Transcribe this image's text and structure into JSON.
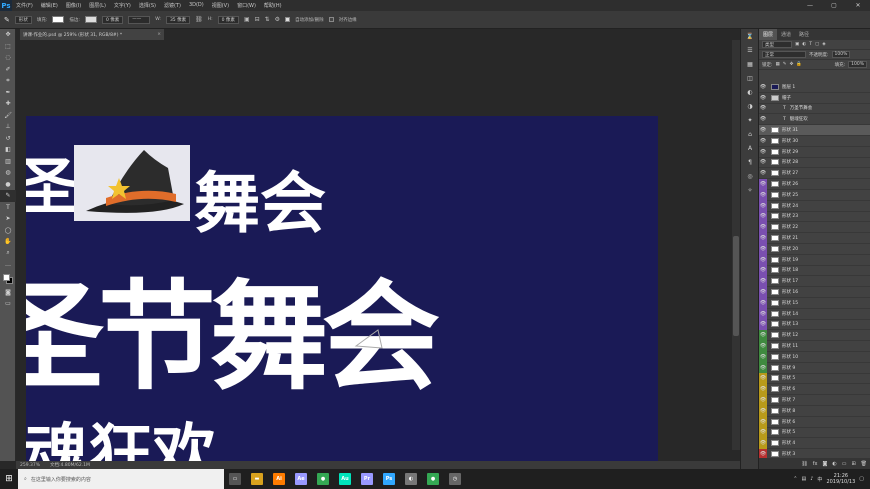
{
  "app": {
    "logo": "Ps"
  },
  "menu": [
    "文件(F)",
    "编辑(E)",
    "图像(I)",
    "图层(L)",
    "文字(Y)",
    "选择(S)",
    "滤镜(T)",
    "3D(D)",
    "视图(V)",
    "窗口(W)",
    "帮助(H)"
  ],
  "options": {
    "mode": "形状",
    "fill_label": "填充:",
    "stroke_label": "描边:",
    "stroke_width": "0 像素",
    "w_label": "W:",
    "w_value": "35 像素",
    "h_label": "H:",
    "h_value": "0 像素",
    "auto_add": "自动添加/删除",
    "align_edges": "对齐边缘"
  },
  "document": {
    "tab": "讲课·作业的.psd @ 259% (形状 31, RGB/8#) *",
    "close": "×",
    "zoom": "259.37%",
    "doc_info": "文档:4.80M/62.1M"
  },
  "panel": {
    "tabs": [
      "图层",
      "通道",
      "路径"
    ],
    "filter": "类型",
    "blend": "正常",
    "opacity_label": "不透明度:",
    "opacity": "100%",
    "lock_label": "锁定:",
    "fill_label": "填充:",
    "fill": "100%"
  },
  "layers": [
    {
      "name": "图层 1",
      "tag": ""
    },
    {
      "name": "帽子",
      "tag": ""
    },
    {
      "name": "万圣节舞会",
      "tag": ""
    },
    {
      "name": "魅魂狂欢",
      "tag": ""
    },
    {
      "name": "形状 31",
      "tag": ""
    },
    {
      "name": "形状 30",
      "tag": ""
    },
    {
      "name": "形状 29",
      "tag": ""
    },
    {
      "name": "形状 28",
      "tag": ""
    },
    {
      "name": "形状 27",
      "tag": ""
    },
    {
      "name": "形状 26",
      "tag": "#7a4fb0"
    },
    {
      "name": "形状 25",
      "tag": "#7a4fb0"
    },
    {
      "name": "形状 24",
      "tag": "#7a4fb0"
    },
    {
      "name": "形状 23",
      "tag": "#7a4fb0"
    },
    {
      "name": "形状 22",
      "tag": "#7a4fb0"
    },
    {
      "name": "形状 21",
      "tag": "#7a4fb0"
    },
    {
      "name": "形状 20",
      "tag": "#7a4fb0"
    },
    {
      "name": "形状 19",
      "tag": "#7a4fb0"
    },
    {
      "name": "形状 18",
      "tag": "#7a4fb0"
    },
    {
      "name": "形状 17",
      "tag": "#7a4fb0"
    },
    {
      "name": "形状 16",
      "tag": "#7a4fb0"
    },
    {
      "name": "形状 15",
      "tag": "#7a4fb0"
    },
    {
      "name": "形状 14",
      "tag": "#7a4fb0"
    },
    {
      "name": "形状 13",
      "tag": "#7a4fb0"
    },
    {
      "name": "形状 12",
      "tag": "#3f8a3f"
    },
    {
      "name": "形状 11",
      "tag": "#3f8a3f"
    },
    {
      "name": "形状 10",
      "tag": "#3f8a3f"
    },
    {
      "name": "形状 9",
      "tag": "#3f8a3f"
    },
    {
      "name": "形状 5",
      "tag": "#b89a1a"
    },
    {
      "name": "形状 6",
      "tag": "#b89a1a"
    },
    {
      "name": "形状 7",
      "tag": "#b89a1a"
    },
    {
      "name": "形状 8",
      "tag": "#b89a1a"
    },
    {
      "name": "形状 6",
      "tag": "#b89a1a"
    },
    {
      "name": "形状 5",
      "tag": "#b89a1a"
    },
    {
      "name": "形状 4",
      "tag": "#b89a1a"
    },
    {
      "name": "形状 3",
      "tag": "#b83030"
    },
    {
      "name": "形状 2",
      "tag": "#b83030"
    },
    {
      "name": "形状 1",
      "tag": "#b83030"
    }
  ],
  "canvas_text": {
    "line1": "圣",
    "line1b": "舞会",
    "line2": "圣节舞会",
    "line3": "魂狂欢"
  },
  "taskbar": {
    "search_placeholder": "在这里输入你要搜索的内容",
    "time": "21:26",
    "date": "2019/10/13",
    "lang": "中"
  },
  "taskbar_apps": [
    {
      "icon": "task-view",
      "color": "#555",
      "glyph": "▭"
    },
    {
      "icon": "file-explorer",
      "color": "#d9a21e",
      "glyph": "▬"
    },
    {
      "icon": "illustrator",
      "color": "#ff7c00",
      "glyph": "Ai"
    },
    {
      "icon": "after-effects",
      "color": "#9999ff",
      "glyph": "Ae"
    },
    {
      "icon": "chrome",
      "color": "#34a853",
      "glyph": "●"
    },
    {
      "icon": "audition",
      "color": "#00e4bb",
      "glyph": "Au"
    },
    {
      "icon": "premiere",
      "color": "#9999ff",
      "glyph": "Pr"
    },
    {
      "icon": "photoshop",
      "color": "#31a8ff",
      "glyph": "Ps"
    },
    {
      "icon": "app-circle",
      "color": "#777",
      "glyph": "◐"
    },
    {
      "icon": "chrome-2",
      "color": "#34a853",
      "glyph": "●"
    },
    {
      "icon": "app-clock",
      "color": "#666",
      "glyph": "◷"
    }
  ]
}
